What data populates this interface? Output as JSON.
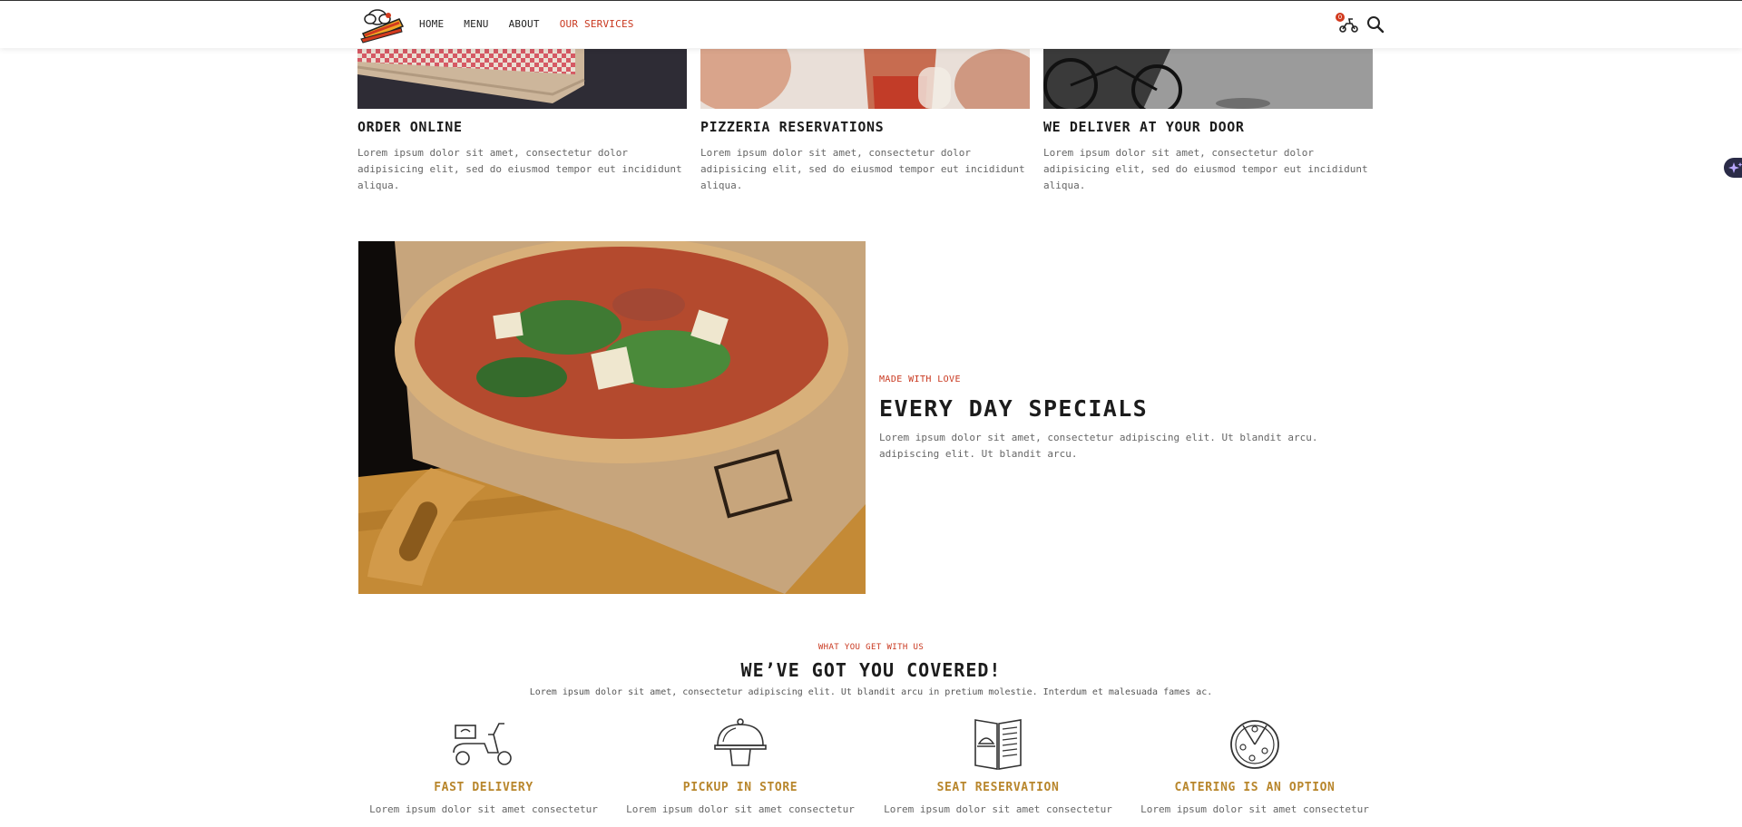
{
  "nav": {
    "items": [
      {
        "label": "HOME"
      },
      {
        "label": "MENU"
      },
      {
        "label": "ABOUT"
      },
      {
        "label": "OUR SERVICES"
      }
    ],
    "active": "OUR SERVICES",
    "cart_count": "0",
    "accent_color": "#c9381f"
  },
  "services": [
    {
      "title": "ORDER ONLINE",
      "text": "Lorem ipsum dolor sit amet, consectetur dolor adipisicing elit, sed do eiusmod tempor eut incididunt aliqua."
    },
    {
      "title": "PIZZERIA RESERVATIONS",
      "text": "Lorem ipsum dolor sit amet, consectetur dolor adipisicing elit, sed do eiusmod tempor eut incididunt aliqua."
    },
    {
      "title": "WE DELIVER AT YOUR DOOR",
      "text": "Lorem ipsum dolor sit amet, consectetur dolor adipisicing elit, sed do eiusmod tempor eut incididunt aliqua."
    }
  ],
  "specials": {
    "eyebrow": "MADE WITH LOVE",
    "title": "EVERY DAY SPECIALS",
    "text": "Lorem ipsum dolor sit amet, consectetur adipiscing elit. Ut blandit arcu. adipiscing elit. Ut blandit arcu."
  },
  "covered": {
    "eyebrow": "WHAT YOU GET WITH US",
    "title": "WE’VE GOT YOU COVERED!",
    "text": "Lorem ipsum dolor sit amet, consectetur adipiscing elit. Ut blandit arcu in pretium molestie. Interdum et malesuada fames ac."
  },
  "features": [
    {
      "title": "FAST DELIVERY",
      "text": "Lorem ipsum dolor sit amet consectetur",
      "icon": "scooter-icon"
    },
    {
      "title": "PICKUP IN STORE",
      "text": "Lorem ipsum dolor sit amet consectetur",
      "icon": "cloche-icon"
    },
    {
      "title": "SEAT RESERVATION",
      "text": "Lorem ipsum dolor sit amet consectetur",
      "icon": "menu-book-icon"
    },
    {
      "title": "CATERING IS AN OPTION",
      "text": "Lorem ipsum dolor sit amet consectetur",
      "icon": "pizza-icon"
    }
  ],
  "colors": {
    "feature_title": "#b8862c",
    "eyebrow": "#c9381f"
  }
}
